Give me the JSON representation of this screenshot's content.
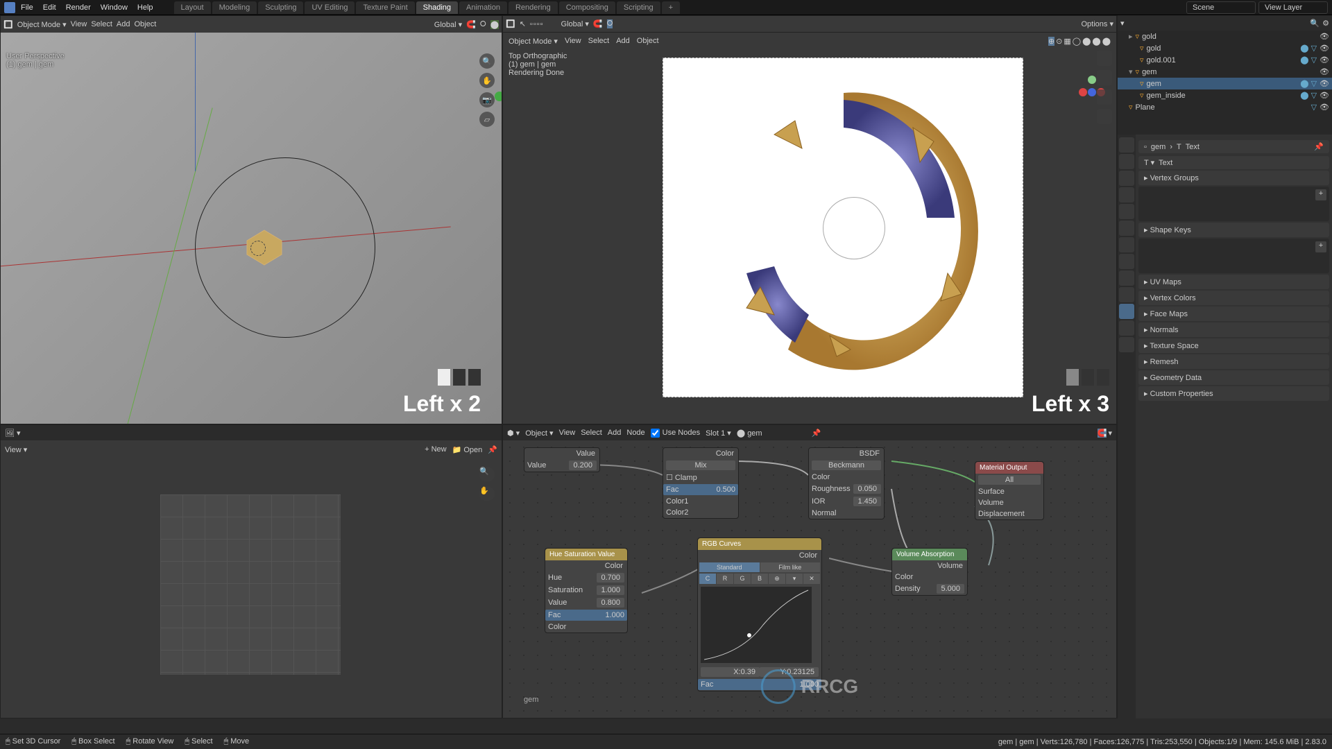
{
  "menu": {
    "file": "File",
    "edit": "Edit",
    "render": "Render",
    "window": "Window",
    "help": "Help"
  },
  "workspaces": {
    "layout": "Layout",
    "modeling": "Modeling",
    "sculpting": "Sculpting",
    "uv": "UV Editing",
    "texture": "Texture Paint",
    "shading": "Shading",
    "animation": "Animation",
    "rendering": "Rendering",
    "compositing": "Compositing",
    "scripting": "Scripting"
  },
  "scene_field": "Scene",
  "viewlayer_field": "View Layer",
  "vp_left": {
    "mode": "Object Mode",
    "menus": {
      "view": "View",
      "select": "Select",
      "add": "Add",
      "object": "Object"
    },
    "orient": "Global",
    "info1": "User Perspective",
    "info2": "(1) gem | gem",
    "overlay": "Left x 2"
  },
  "vp_right": {
    "mode": "Object Mode",
    "menus": {
      "view": "View",
      "select": "Select",
      "add": "Add",
      "object": "Object"
    },
    "orient": "Global",
    "options": "Options",
    "info1": "Top Orthographic",
    "info2": "(1) gem | gem",
    "info3": "Rendering Done",
    "overlay": "Left x 3"
  },
  "outliner": {
    "items": [
      {
        "name": "gold",
        "indent": 1
      },
      {
        "name": "gold",
        "indent": 2
      },
      {
        "name": "gold.001",
        "indent": 2
      },
      {
        "name": "gem",
        "indent": 1,
        "expanded": true
      },
      {
        "name": "gem",
        "indent": 2,
        "selected": true
      },
      {
        "name": "gem_inside",
        "indent": 2
      },
      {
        "name": "Plane",
        "indent": 1
      }
    ]
  },
  "props": {
    "obj_name": "gem",
    "data_type": "Text",
    "text_name": "Text",
    "panels": [
      "Vertex Groups",
      "Shape Keys",
      "UV Maps",
      "Vertex Colors",
      "Face Maps",
      "Normals",
      "Texture Space",
      "Remesh",
      "Geometry Data",
      "Custom Properties"
    ]
  },
  "uv": {
    "view": "View",
    "new": "New",
    "open": "Open"
  },
  "nodes": {
    "mode": "Object",
    "menus": {
      "view": "View",
      "select": "Select",
      "add": "Add",
      "node": "Node"
    },
    "use_nodes": "Use Nodes",
    "slot": "Slot 1",
    "mat": "gem",
    "obj_label": "gem",
    "value_node": {
      "out": "Value",
      "value": "0.200"
    },
    "mix_top": {
      "out": "Color",
      "blend": "Mix",
      "clamp": "Clamp",
      "fac": "Fac",
      "fac_v": "0.500",
      "c1": "Color1",
      "c2": "Color2"
    },
    "glass": {
      "out": "BSDF",
      "dist": "Beckmann",
      "color": "Color",
      "rough": "Roughness",
      "rough_v": "0.050",
      "ior": "IOR",
      "ior_v": "1.450",
      "normal": "Normal"
    },
    "hsv": {
      "title": "Hue Saturation Value",
      "out": "Color",
      "hue": "Hue",
      "hue_v": "0.700",
      "sat": "Saturation",
      "sat_v": "1.000",
      "val": "Value",
      "val_v": "0.800",
      "fac": "Fac",
      "fac_v": "1.000",
      "color": "Color"
    },
    "rgb": {
      "title": "RGB Curves",
      "out": "Color",
      "std": "Standard",
      "film": "Film like",
      "c": "C",
      "r": "R",
      "g": "G",
      "b": "B",
      "x": "X:0.39",
      "y": "Y:0.23125",
      "fac": "Fac",
      "fac_v": "1.000"
    },
    "vol": {
      "title": "Volume Absorption",
      "out": "Volume",
      "color": "Color",
      "density": "Density",
      "density_v": "5.000"
    },
    "output": {
      "title": "Material Output",
      "all": "All",
      "surface": "Surface",
      "volume": "Volume",
      "disp": "Displacement"
    }
  },
  "status": {
    "cursor": "Set 3D Cursor",
    "box": "Box Select",
    "rotate": "Rotate View",
    "select": "Select",
    "move": "Move",
    "info": "gem | gem | Verts:126,780 | Faces:126,775 | Tris:253,550 | Objects:1/9 | Mem: 145.6 MiB | 2.83.0"
  },
  "watermark": "RRCG"
}
